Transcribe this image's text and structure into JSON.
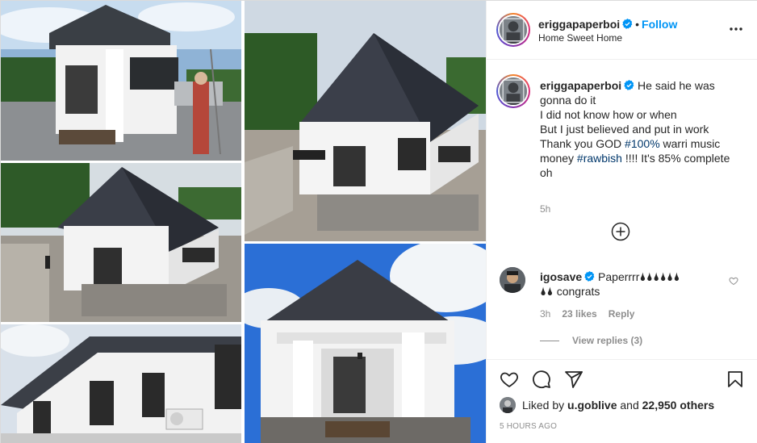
{
  "post": {
    "username": "eriggapaperboi",
    "separator": "•",
    "follow_label": "Follow",
    "location": "Home Sweet Home",
    "colors": {
      "accent_blue": "#0095f6",
      "hashtag": "#00376b",
      "muted": "#8e8e8e",
      "text": "#262626"
    }
  },
  "caption": {
    "username": "eriggapaperboi",
    "line1": "He said he was",
    "line2": "gonna do it",
    "line3": "I did not know how or when",
    "line4": "But I just believed and put in work",
    "line5_pre": "Thank you GOD ",
    "tag1": "#100%",
    "line5_post": " warri music",
    "line6_pre": "money ",
    "tag2": "#rawbish",
    "line6_post": " !!!! It's 85% complete",
    "line7": "oh",
    "time": "5h"
  },
  "comment": {
    "username": "igosave",
    "text_line1": "Paperrrr🌢🌢🌢🌢🌢🌢",
    "text_line2": "🌢🌢 congrats",
    "time": "3h",
    "likes": "23 likes",
    "reply_label": "Reply",
    "view_replies": "View replies (3)"
  },
  "likes": {
    "prefix": "Liked by ",
    "user": "u.goblive",
    "middle": " and ",
    "count": "22,950 others"
  },
  "timestamp": "5 HOURS AGO",
  "icons": [
    "verified-badge-icon",
    "more-options-icon",
    "plus-circle-icon",
    "heart-icon",
    "comment-icon",
    "share-icon",
    "bookmark-icon"
  ]
}
